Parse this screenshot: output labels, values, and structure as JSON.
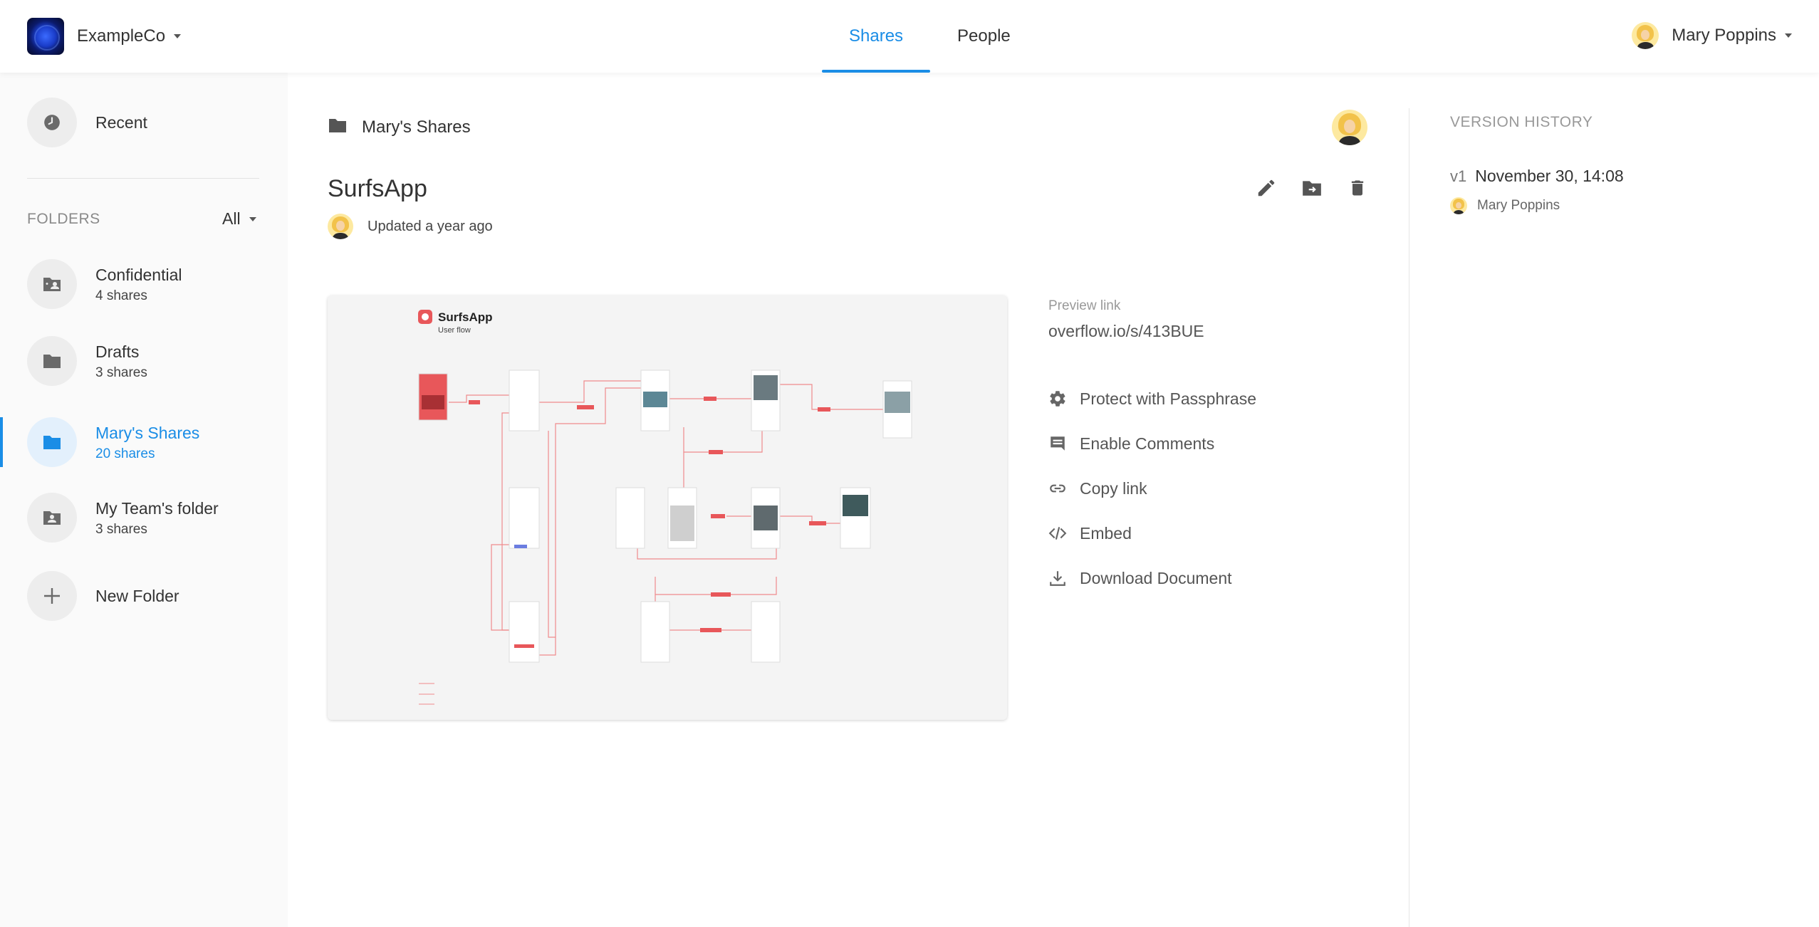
{
  "header": {
    "org_name": "ExampleCo",
    "tabs": [
      {
        "label": "Shares",
        "active": true
      },
      {
        "label": "People",
        "active": false
      }
    ],
    "user_name": "Mary Poppins"
  },
  "sidebar": {
    "recent_label": "Recent",
    "folders_label": "FOLDERS",
    "folders_filter": "All",
    "folders": [
      {
        "name": "Confidential",
        "count": "4 shares",
        "icon": "shared-folder-icon"
      },
      {
        "name": "Drafts",
        "count": "3 shares",
        "icon": "folder-icon"
      },
      {
        "name": "Mary's Shares",
        "count": "20 shares",
        "icon": "folder-icon",
        "active": true
      },
      {
        "name": "My Team's folder",
        "count": "3 shares",
        "icon": "shared-folder-icon"
      }
    ],
    "new_folder_label": "New Folder"
  },
  "main": {
    "breadcrumb": "Mary's Shares",
    "title": "SurfsApp",
    "updated": "Updated a year ago",
    "preview": {
      "brand": "SurfsApp",
      "subtitle": "User flow"
    },
    "preview_link_label": "Preview link",
    "preview_link_url": "overflow.io/s/413BUE",
    "actions": [
      {
        "label": "Protect with Passphrase",
        "icon": "gear-icon"
      },
      {
        "label": "Enable Comments",
        "icon": "comment-icon"
      },
      {
        "label": "Copy link",
        "icon": "link-icon"
      },
      {
        "label": "Embed",
        "icon": "code-icon"
      },
      {
        "label": "Download Document",
        "icon": "download-icon"
      }
    ]
  },
  "version_history": {
    "title": "VERSION HISTORY",
    "entries": [
      {
        "version": "v1",
        "date": "November 30, 14:08",
        "user": "Mary Poppins"
      }
    ]
  },
  "colors": {
    "accent": "#1a8de6",
    "flow_red": "#e8575a"
  }
}
